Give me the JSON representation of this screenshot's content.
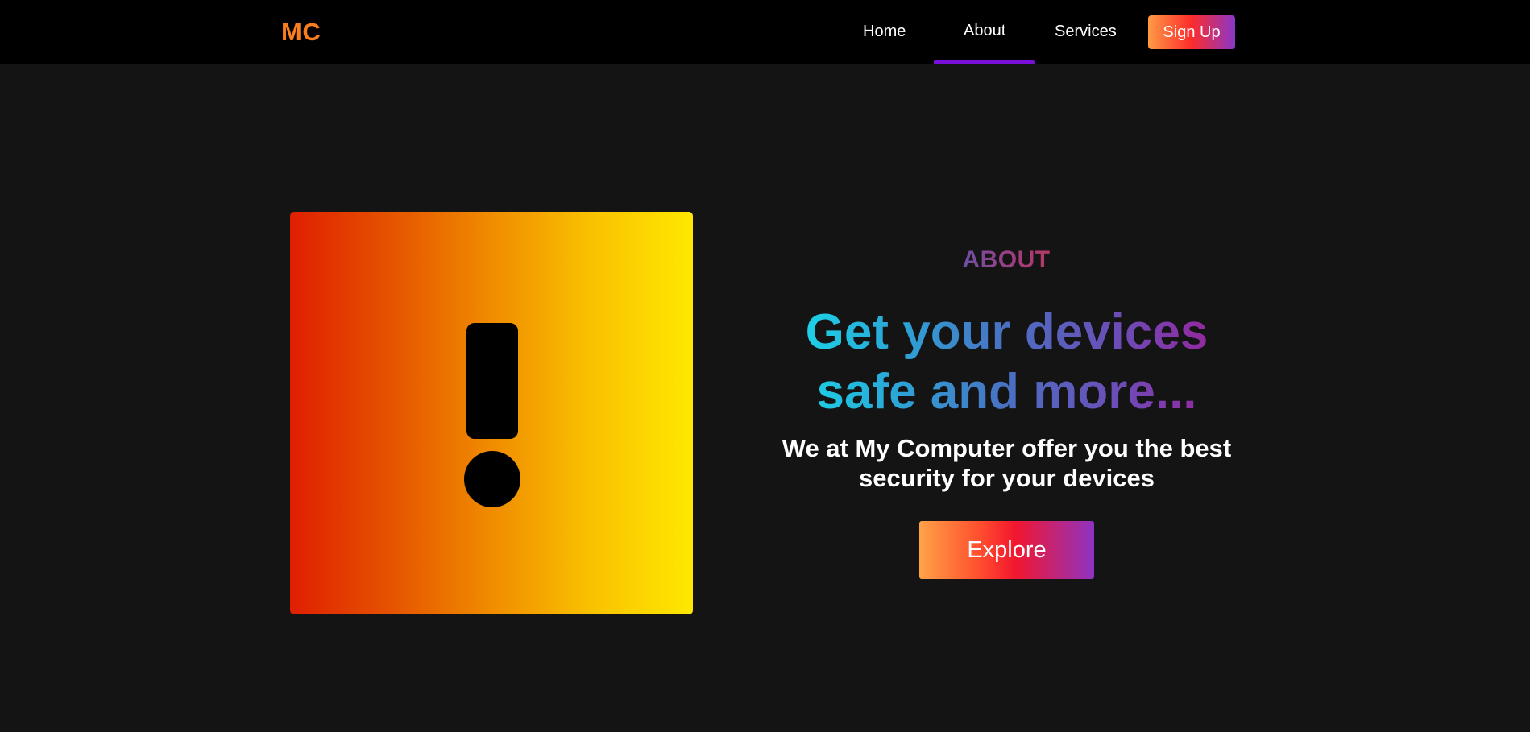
{
  "nav": {
    "logo": "MC",
    "links": [
      "Home",
      "About",
      "Services"
    ],
    "active": "About",
    "signup_label": "Sign Up"
  },
  "hero": {
    "icon": "exclamation-icon",
    "eyebrow": "ABOUT",
    "headline": "Get your devices safe and more...",
    "subtext": "We at My Computer offer you the best security for your devices",
    "cta_label": "Explore"
  },
  "colors": {
    "page_background": "#141414",
    "navbar_background": "#000000",
    "logo": "#f77d1f",
    "active_underline": "#7a0fd9",
    "headline_gradient": [
      "#17e0ea",
      "#4a70c2",
      "#a11c96"
    ],
    "card_gradient": [
      "#e01f00",
      "#f08c00",
      "#ffe800"
    ],
    "button_gradient": [
      "#ff9a44",
      "#f2162e",
      "#8a36c9"
    ]
  }
}
